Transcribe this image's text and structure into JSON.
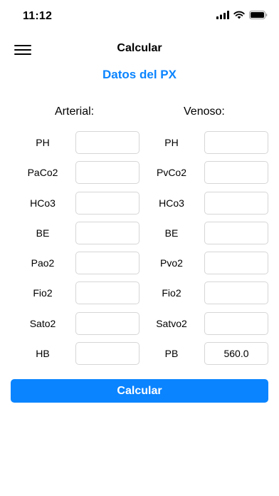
{
  "status_bar": {
    "time": "11:12",
    "icons": [
      "signal-icon",
      "wifi-icon",
      "battery-icon"
    ]
  },
  "nav": {
    "title": "Calcular",
    "menu_icon": "hamburger-menu-icon"
  },
  "section_title": "Datos del PX",
  "columns": {
    "arterial": "Arterial:",
    "venoso": "Venoso:"
  },
  "arterial_rows": [
    {
      "label": "PH",
      "value": ""
    },
    {
      "label": "PaCo2",
      "value": ""
    },
    {
      "label": "HCo3",
      "value": ""
    },
    {
      "label": "BE",
      "value": ""
    },
    {
      "label": "Pao2",
      "value": ""
    },
    {
      "label": "Fio2",
      "value": ""
    },
    {
      "label": "Sato2",
      "value": ""
    },
    {
      "label": "HB",
      "value": ""
    }
  ],
  "venoso_rows": [
    {
      "label": "PH",
      "value": ""
    },
    {
      "label": "PvCo2",
      "value": ""
    },
    {
      "label": "HCo3",
      "value": ""
    },
    {
      "label": "BE",
      "value": ""
    },
    {
      "label": "Pvo2",
      "value": ""
    },
    {
      "label": "Fio2",
      "value": ""
    },
    {
      "label": "Satvo2",
      "value": ""
    },
    {
      "label": "PB",
      "value": "560.0"
    }
  ],
  "calculate_button": "Calcular",
  "colors": {
    "accent": "#0a84ff",
    "field_border": "#d6d6d6"
  }
}
